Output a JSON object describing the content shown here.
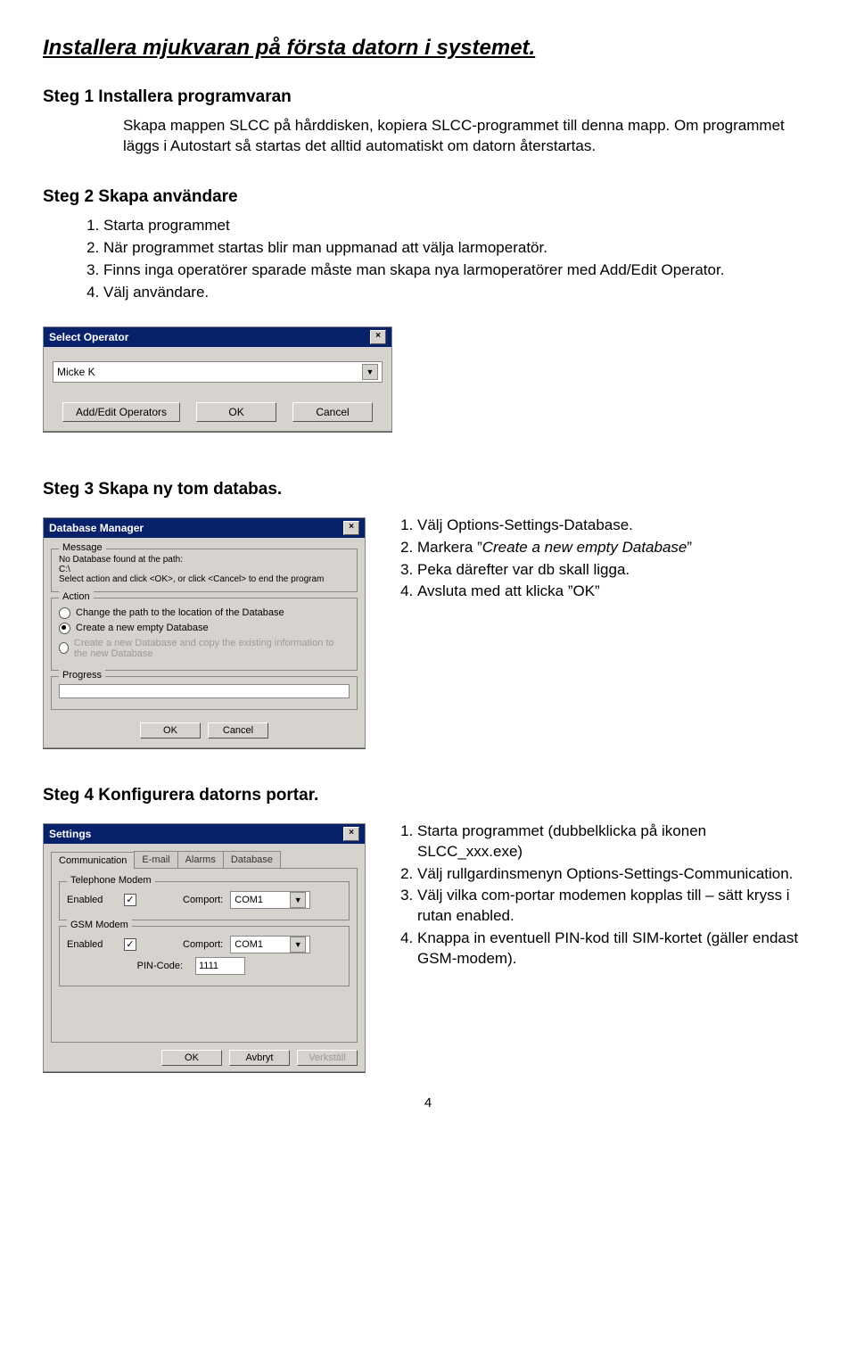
{
  "page": {
    "title": "Installera mjukvaran på första datorn i systemet.",
    "number": "4"
  },
  "step1": {
    "heading": "Steg 1 Installera programvaran",
    "para1": "Skapa mappen SLCC på hårddisken, kopiera SLCC-programmet till denna mapp. Om programmet läggs i Autostart så startas det alltid automatiskt om datorn återstartas."
  },
  "step2": {
    "heading": "Steg 2 Skapa användare",
    "items": [
      "Starta programmet",
      "När programmet startas blir man uppmanad att välja larmoperatör.",
      "Finns inga operatörer sparade måste man skapa nya larmoperatörer med Add/Edit Operator.",
      "Välj användare."
    ]
  },
  "selectOperator": {
    "title": "Select Operator",
    "value": "Micke K",
    "buttons": {
      "addedit": "Add/Edit Operators",
      "ok": "OK",
      "cancel": "Cancel"
    }
  },
  "step3": {
    "heading": "Steg 3 Skapa ny tom databas.",
    "items": [
      "Välj Options-Settings-Database.",
      "Markera ”Create a new empty Database”",
      "Peka därefter var db skall ligga.",
      "Avsluta med att klicka ”OK”"
    ]
  },
  "dbManager": {
    "title": "Database Manager",
    "message": {
      "legend": "Message",
      "line1": "No Database found at the path:",
      "line2": "C:\\",
      "line3": "Select action and click <OK>, or click <Cancel> to end the program"
    },
    "action": {
      "legend": "Action",
      "opt1": "Change the path to the location of the Database",
      "opt2": "Create a new empty Database",
      "opt3": "Create a new Database and copy the existing information to the new Database"
    },
    "progressLegend": "Progress",
    "buttons": {
      "ok": "OK",
      "cancel": "Cancel"
    }
  },
  "step4": {
    "heading": "Steg 4 Konfigurera datorns portar.",
    "items": [
      "Starta programmet (dubbelklicka på ikonen SLCC_xxx.exe)",
      "Välj rullgardinsmenyn Options-Settings-Communication.",
      "Välj vilka com-portar modemen kopplas till – sätt kryss i rutan enabled.",
      "Knappa in eventuell PIN-kod till SIM-kortet (gäller endast GSM-modem)."
    ]
  },
  "settings": {
    "title": "Settings",
    "tabs": {
      "comm": "Communication",
      "email": "E-mail",
      "alarms": "Alarms",
      "database": "Database"
    },
    "tel": {
      "legend": "Telephone Modem",
      "enabled": "Enabled",
      "comport": "Comport:",
      "comportVal": "COM1"
    },
    "gsm": {
      "legend": "GSM Modem",
      "enabled": "Enabled",
      "comport": "Comport:",
      "comportVal": "COM1",
      "pinlabel": "PIN-Code:",
      "pinval": "1111"
    },
    "buttons": {
      "ok": "OK",
      "cancel": "Avbryt",
      "apply": "Verkställ"
    }
  }
}
